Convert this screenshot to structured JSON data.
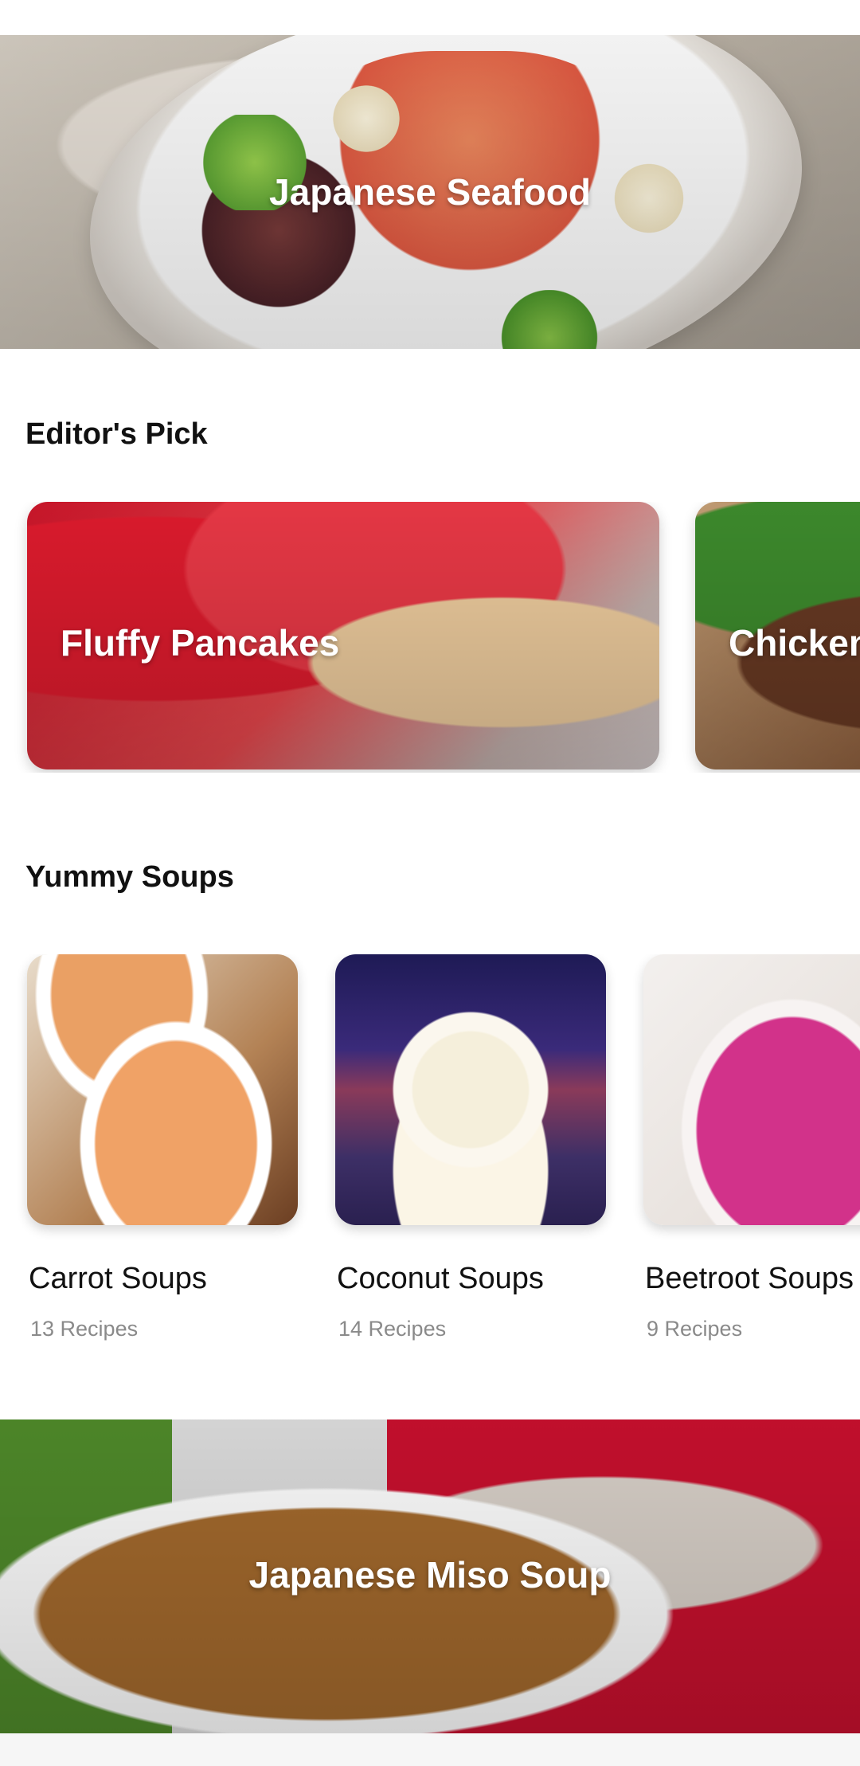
{
  "hero": {
    "title": "Japanese Seafood"
  },
  "sections": {
    "editors_pick": {
      "title": "Editor's Pick",
      "cards": [
        {
          "label": "Fluffy Pancakes"
        },
        {
          "label": "Chicken"
        }
      ]
    },
    "yummy_soups": {
      "title": "Yummy Soups",
      "items": [
        {
          "name": "Carrot Soups",
          "count": "13 Recipes"
        },
        {
          "name": "Coconut Soups",
          "count": "14 Recipes"
        },
        {
          "name": "Beetroot Soups",
          "count": "9 Recipes"
        }
      ]
    }
  },
  "bottom_banner": {
    "title": "Japanese Miso Soup"
  },
  "colors": {
    "text_primary": "#111111",
    "text_secondary": "#8a8a8a",
    "overlay_text": "#ffffff",
    "background": "#ffffff"
  }
}
